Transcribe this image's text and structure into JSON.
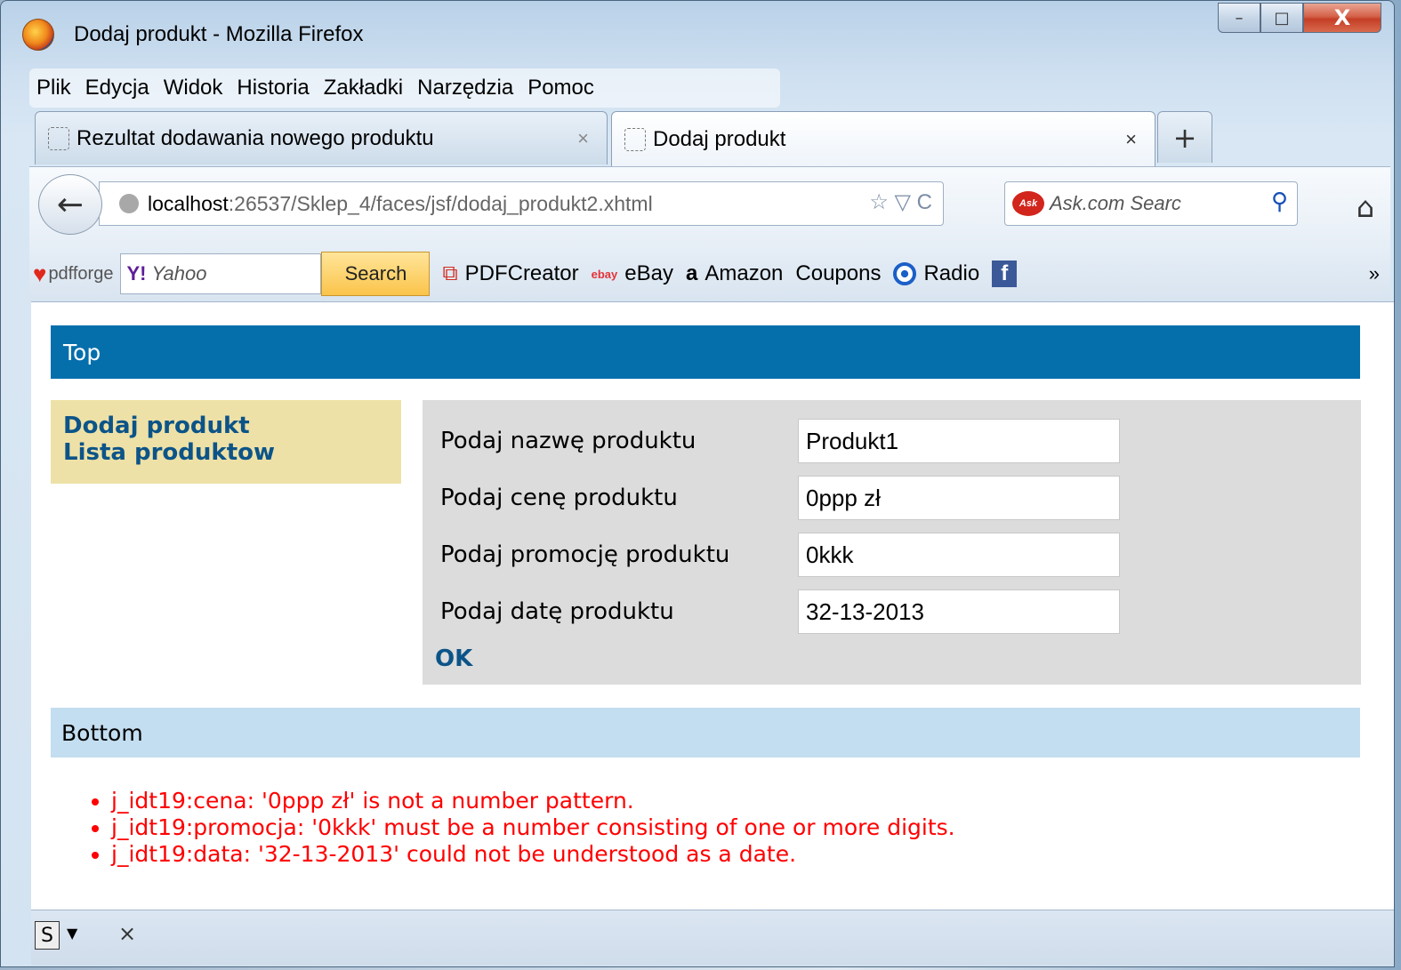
{
  "window": {
    "title": "Dodaj produkt - Mozilla Firefox",
    "minimize": "–",
    "maximize": "□",
    "close": "X"
  },
  "menu": [
    "Plik",
    "Edycja",
    "Widok",
    "Historia",
    "Zakładki",
    "Narzędzia",
    "Pomoc"
  ],
  "tabs": [
    {
      "label": "Rezultat dodawania nowego produktu",
      "close": "×"
    },
    {
      "label": "Dodaj produkt",
      "close": "×"
    }
  ],
  "new_tab": "+",
  "navbar": {
    "back": "←",
    "url_host": "localhost",
    "url_path": ":26537/Sklep_4/faces/jsf/dodaj_produkt2.xhtml",
    "url_icons": "☆ ▽ C",
    "search_placeholder": "Ask.com Searc",
    "search_logo": "Ask",
    "search_icon": "⚲",
    "home": "⌂"
  },
  "bookmarks": {
    "pdfforge": "pdfforge",
    "yahoo_logo": "Y!",
    "yahoo_text": "Yahoo",
    "search_button": "Search",
    "items": [
      "PDFCreator",
      "eBay",
      "Amazon",
      "Coupons",
      "Radio"
    ],
    "ebay_icon": "ebay",
    "amazon_icon": "a",
    "fb_icon": "f",
    "more": "»"
  },
  "page": {
    "top": "Top",
    "menu_links": [
      "Dodaj produkt",
      "Lista produktow"
    ],
    "fields": [
      {
        "label": "Podaj nazwę produktu",
        "value": "Produkt1"
      },
      {
        "label": "Podaj cenę produktu",
        "value": "0ppp zł"
      },
      {
        "label": "Podaj promocję produktu",
        "value": "0kkk"
      },
      {
        "label": "Podaj datę produktu",
        "value": "32-13-2013"
      }
    ],
    "ok": "OK",
    "bottom": "Bottom",
    "errors": [
      "j_idt19:cena: '0ppp zł' is not a number pattern.",
      "j_idt19:promocja: '0kkk' must be a number consisting of one or more digits.",
      "j_idt19:data: '32-13-2013' could not be understood as a date."
    ]
  },
  "statusbar": {
    "icon": "S",
    "close": "×"
  }
}
